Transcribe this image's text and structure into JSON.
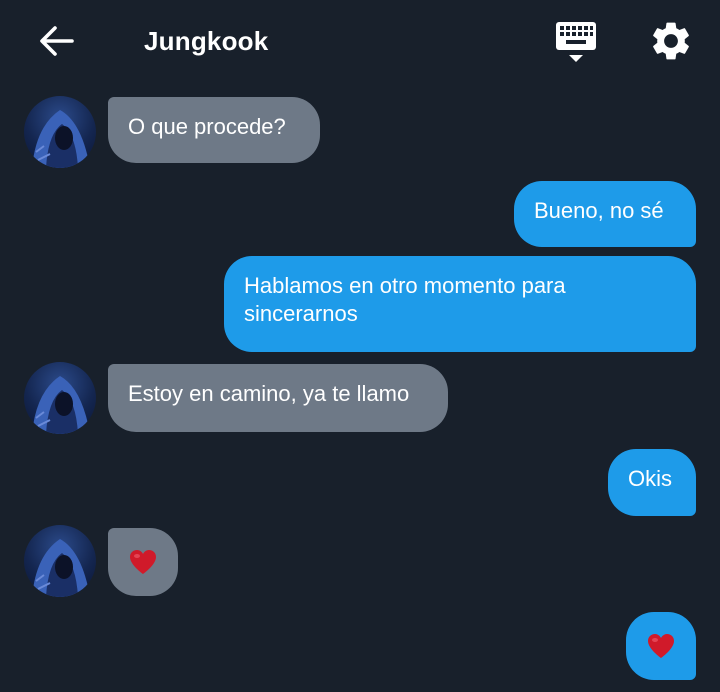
{
  "header": {
    "title": "Jungkook",
    "back_icon": "arrow-left-icon",
    "keyboard_icon": "keyboard-icon",
    "settings_icon": "gear-icon"
  },
  "colors": {
    "background": "#18202b",
    "incoming_bubble": "#6e7987",
    "outgoing_bubble": "#1e9be9",
    "heart": "#d01a2a"
  },
  "messages": [
    {
      "from": "contact",
      "text": "O que procede?"
    },
    {
      "from": "me",
      "text": "Bueno, no sé"
    },
    {
      "from": "me",
      "text": "Hablamos en otro momento para sincerarnos"
    },
    {
      "from": "contact",
      "text": "Estoy en camino, ya te llamo"
    },
    {
      "from": "me",
      "text": "Okis"
    },
    {
      "from": "contact",
      "text": "",
      "icon": "heart-icon"
    },
    {
      "from": "me",
      "text": "",
      "icon": "heart-icon"
    }
  ]
}
